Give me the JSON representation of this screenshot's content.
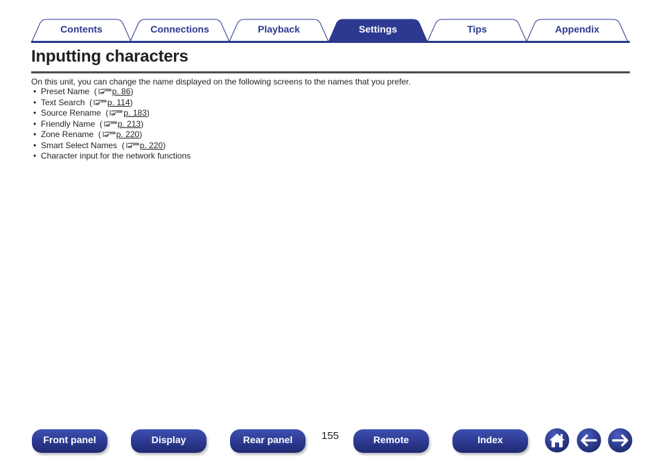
{
  "tabs": [
    {
      "label": "Contents",
      "active": false
    },
    {
      "label": "Connections",
      "active": false
    },
    {
      "label": "Playback",
      "active": false
    },
    {
      "label": "Settings",
      "active": true
    },
    {
      "label": "Tips",
      "active": false
    },
    {
      "label": "Appendix",
      "active": false
    }
  ],
  "page": {
    "title": "Inputting characters",
    "intro": "On this unit, you can change the name displayed on the following screens to the names that you prefer.",
    "items": [
      {
        "text": "Preset Name",
        "ref": "p. 86"
      },
      {
        "text": "Text Search",
        "ref": "p. 114"
      },
      {
        "text": "Source Rename",
        "ref": "p. 183"
      },
      {
        "text": "Friendly Name",
        "ref": "p. 213"
      },
      {
        "text": "Zone Rename",
        "ref": "p. 220"
      },
      {
        "text": "Smart Select Names",
        "ref": "p. 220"
      },
      {
        "text": "Character input for the network functions",
        "ref": null
      }
    ],
    "bullet": "•",
    "ref_open": "(",
    "ref_close": ")"
  },
  "footer": {
    "buttons": {
      "front_panel": "Front panel",
      "display": "Display",
      "rear_panel": "Rear panel",
      "remote": "Remote",
      "index": "Index"
    },
    "page_number": "155",
    "icons": {
      "home": "home-icon",
      "back": "arrow-left-icon",
      "forward": "arrow-right-icon"
    }
  },
  "colors": {
    "brand_blue": "#2b3990",
    "text": "#231f20",
    "rule": "#4d4d4f"
  }
}
